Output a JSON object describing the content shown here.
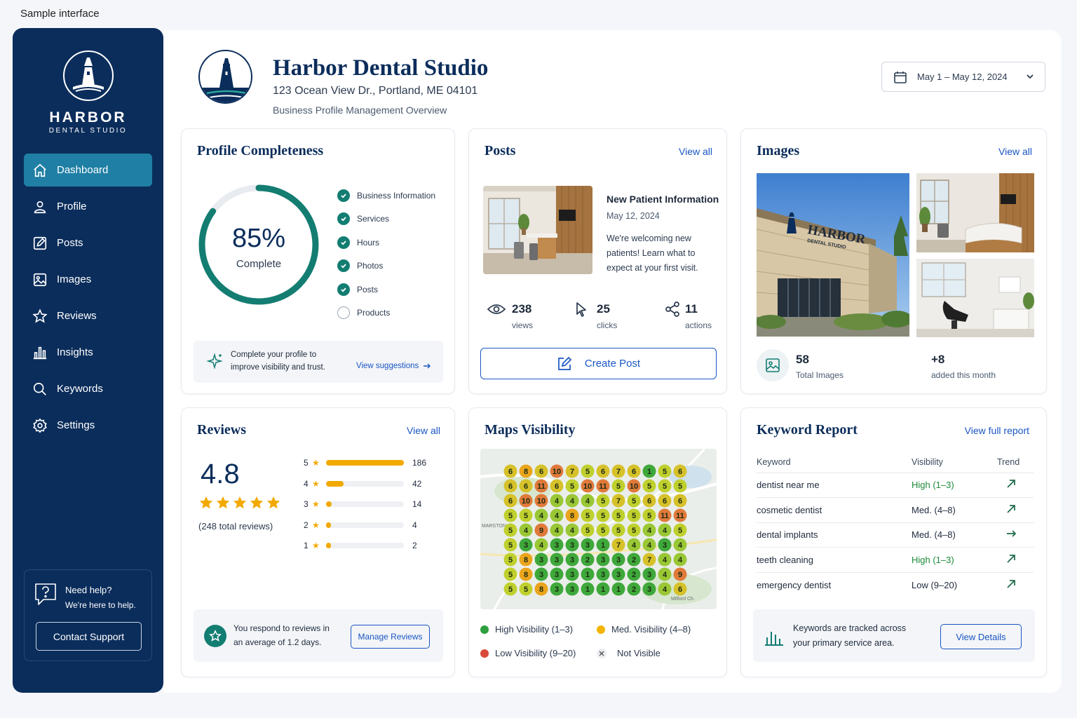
{
  "caption": "Sample interface",
  "colors": {
    "navy": "#0b2d5b",
    "teal": "#137d72",
    "accent": "#1a56c4",
    "star": "#f2a900",
    "high": "#2e9e3f",
    "med": "#f2b500",
    "low": "#d94a3a"
  },
  "sidebar": {
    "brand_name": "HARBOR",
    "brand_sub": "DENTAL STUDIO",
    "items": [
      {
        "label": "Dashboard",
        "icon": "home-icon",
        "active": true
      },
      {
        "label": "Profile",
        "icon": "user-icon"
      },
      {
        "label": "Posts",
        "icon": "edit-icon"
      },
      {
        "label": "Images",
        "icon": "image-icon"
      },
      {
        "label": "Reviews",
        "icon": "star-icon"
      },
      {
        "label": "Insights",
        "icon": "bar-chart-icon"
      },
      {
        "label": "Keywords",
        "icon": "search-icon"
      },
      {
        "label": "Settings",
        "icon": "gear-icon"
      }
    ],
    "help": {
      "title": "Need help?",
      "subtitle": "We're here to help.",
      "button": "Contact Support"
    }
  },
  "header": {
    "name": "Harbor Dental Studio",
    "address": "123 Ocean View Dr., Portland, ME 04101",
    "subtitle": "Business Profile Management Overview",
    "date_range": "May 1 – May 12, 2024"
  },
  "profile": {
    "title": "Profile Completeness",
    "percent_label": "85%",
    "percent": 85,
    "complete_label": "Complete",
    "items": [
      {
        "label": "Business Information",
        "done": true
      },
      {
        "label": "Services",
        "done": true
      },
      {
        "label": "Hours",
        "done": true
      },
      {
        "label": "Photos",
        "done": true
      },
      {
        "label": "Posts",
        "done": true
      },
      {
        "label": "Products",
        "done": false
      }
    ],
    "tip_line1": "Complete your profile to",
    "tip_line2": "improve visibility and trust.",
    "tip_link": "View suggestions"
  },
  "posts": {
    "title": "Posts",
    "view_all": "View all",
    "post_title": "New Patient Information",
    "post_date": "May 12, 2024",
    "post_line1": "We're welcoming new",
    "post_line2": "patients! Learn what to",
    "post_line3": "expect at your first visit.",
    "stats": [
      {
        "value": "238",
        "label": "views"
      },
      {
        "value": "25",
        "label": "clicks"
      },
      {
        "value": "11",
        "label": "actions"
      }
    ],
    "create_button": "Create Post"
  },
  "images": {
    "title": "Images",
    "view_all": "View all",
    "sign_name": "HARBOR",
    "sign_sub": "DENTAL STUDIO",
    "total_value": "58",
    "total_label": "Total Images",
    "added_value": "+8",
    "added_label": "added this month"
  },
  "reviews": {
    "title": "Reviews",
    "view_all": "View all",
    "rating": "4.8",
    "total": "(248 total reviews)",
    "rows": [
      {
        "stars": "5",
        "count": "186",
        "value": 186
      },
      {
        "stars": "4",
        "count": "42",
        "value": 42
      },
      {
        "stars": "3",
        "count": "14",
        "value": 14
      },
      {
        "stars": "2",
        "count": "4",
        "value": 4
      },
      {
        "stars": "1",
        "count": "2",
        "value": 2
      }
    ],
    "respond_line1": "You respond to reviews in",
    "respond_line2": "an average of 1.2 days.",
    "manage_button": "Manage Reviews"
  },
  "maps": {
    "title": "Maps Visibility",
    "map_label1": "MARSTON",
    "map_label2": "Milford Ch.",
    "grid": [
      [
        6,
        8,
        6,
        10,
        7,
        5,
        6,
        7,
        6,
        1,
        5,
        6
      ],
      [
        6,
        6,
        11,
        6,
        5,
        10,
        11,
        5,
        10,
        5,
        5,
        5
      ],
      [
        6,
        10,
        10,
        4,
        4,
        4,
        5,
        7,
        5,
        6,
        6,
        6
      ],
      [
        5,
        5,
        4,
        4,
        8,
        5,
        5,
        5,
        5,
        5,
        11,
        11
      ],
      [
        5,
        4,
        9,
        4,
        4,
        5,
        5,
        5,
        5,
        4,
        4,
        5
      ],
      [
        5,
        3,
        4,
        3,
        3,
        3,
        1,
        7,
        4,
        4,
        3,
        4
      ],
      [
        5,
        8,
        3,
        3,
        3,
        2,
        3,
        3,
        2,
        7,
        4,
        4
      ],
      [
        5,
        8,
        3,
        3,
        3,
        1,
        3,
        3,
        2,
        3,
        4,
        9
      ],
      [
        5,
        5,
        8,
        3,
        3,
        1,
        1,
        1,
        2,
        3,
        4,
        6
      ]
    ],
    "legend": [
      {
        "label": "High Visibility (1–3)",
        "color": "#2e9e3f"
      },
      {
        "label": "Med. Visibility (4–8)",
        "color": "#f2b500"
      },
      {
        "label": "Low Visibility (9–20)",
        "color": "#d94a3a"
      },
      {
        "label": "Not Visible",
        "color": "none"
      }
    ]
  },
  "keywords": {
    "title": "Keyword Report",
    "view_full": "View full report",
    "headers": [
      "Keyword",
      "Visibility",
      "Trend"
    ],
    "rows": [
      {
        "keyword": "dentist near me",
        "visibility": "High (1–3)",
        "level": "high",
        "trend": "up"
      },
      {
        "keyword": "cosmetic dentist",
        "visibility": "Med. (4–8)",
        "level": "med",
        "trend": "up"
      },
      {
        "keyword": "dental implants",
        "visibility": "Med. (4–8)",
        "level": "med",
        "trend": "flat"
      },
      {
        "keyword": "teeth cleaning",
        "visibility": "High (1–3)",
        "level": "high",
        "trend": "up"
      },
      {
        "keyword": "emergency dentist",
        "visibility": "Low (9–20)",
        "level": "low",
        "trend": "up"
      }
    ],
    "note_line1": "Keywords are tracked across",
    "note_line2": "your primary service area.",
    "details_button": "View Details"
  }
}
